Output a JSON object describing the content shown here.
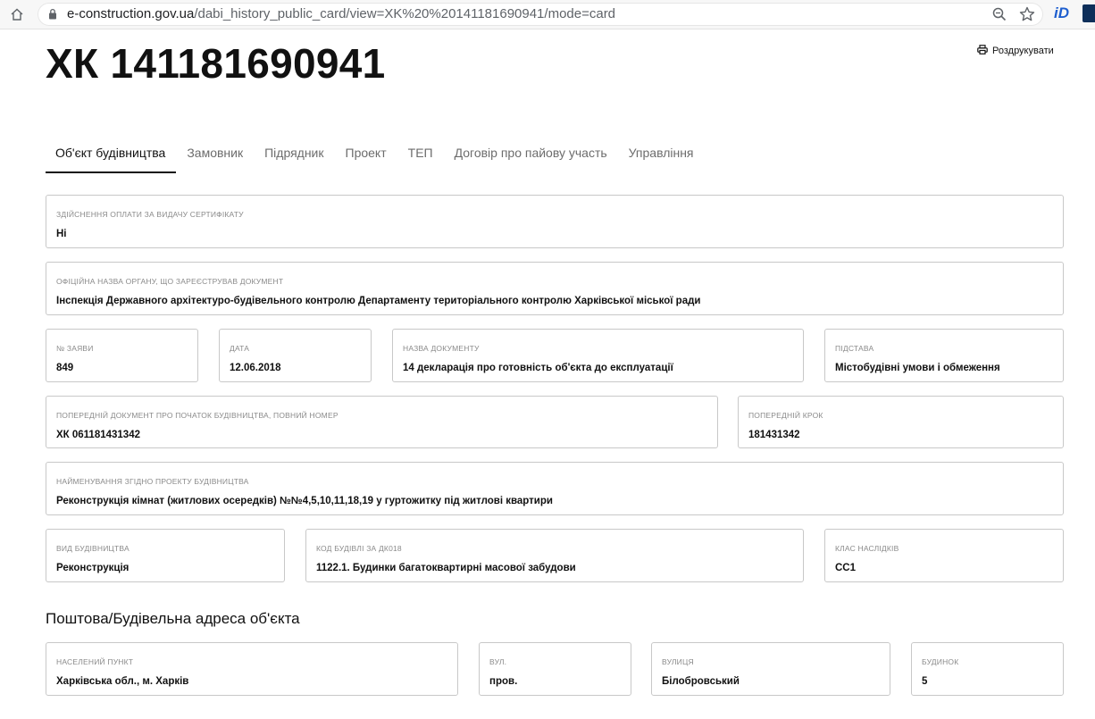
{
  "browser": {
    "url_host": "e-construction.gov.ua",
    "url_path": "/dabi_history_public_card/view=XK%20%20141181690941/mode=card",
    "extension_label": "iD"
  },
  "header": {
    "title": "ХК 141181690941",
    "print_label": "Роздрукувати"
  },
  "tabs": [
    {
      "label": "Об'єкт будівництва",
      "active": true
    },
    {
      "label": "Замовник"
    },
    {
      "label": "Підрядник"
    },
    {
      "label": "Проект"
    },
    {
      "label": "ТЕП"
    },
    {
      "label": "Договір про пайову участь"
    },
    {
      "label": "Управління"
    }
  ],
  "fields": {
    "payment": {
      "label": "Здійснення оплати за видачу сертифікату",
      "value": "Ні"
    },
    "authority": {
      "label": "Офіційна назва органу, що зареєстрував документ",
      "value": "Інспекція Державного архітектуро-будівельного контролю Департаменту територіального контролю Харківської міської ради"
    },
    "application_no": {
      "label": "№ заяви",
      "value": "849"
    },
    "date": {
      "label": "Дата",
      "value": "12.06.2018"
    },
    "document_name": {
      "label": "Назва документу",
      "value": "14 декларація про готовність об'єкта до експлуатації"
    },
    "basis": {
      "label": "Підстава",
      "value": "Містобудівні умови і обмеження"
    },
    "prev_document": {
      "label": "Попередній документ про початок будівництва, повний номер",
      "value": "ХК 061181431342"
    },
    "prev_step": {
      "label": "Попередній крок",
      "value": "181431342"
    },
    "project_name": {
      "label": "Найменування згідно проекту будівництва",
      "value": "Реконструкція кімнат (житлових осередків) №№4,5,10,11,18,19 у гуртожитку під житлові квартири"
    },
    "construction_type": {
      "label": "Вид будівництва",
      "value": "Реконструкція"
    },
    "building_code": {
      "label": "Код будівлі за ДК018",
      "value": "1122.1. Будинки багатоквартирні масової забудови"
    },
    "consequence_class": {
      "label": "Клас наслідків",
      "value": "СС1"
    }
  },
  "address": {
    "heading": "Поштова/Будівельна адреса об'єкта",
    "settlement": {
      "label": "Населений пункт",
      "value": "Харківська обл., м. Харків"
    },
    "street_type": {
      "label": "Вул.",
      "value": "пров."
    },
    "street": {
      "label": "Вулиця",
      "value": "Білобровський"
    },
    "house": {
      "label": "Будинок",
      "value": "5"
    }
  }
}
